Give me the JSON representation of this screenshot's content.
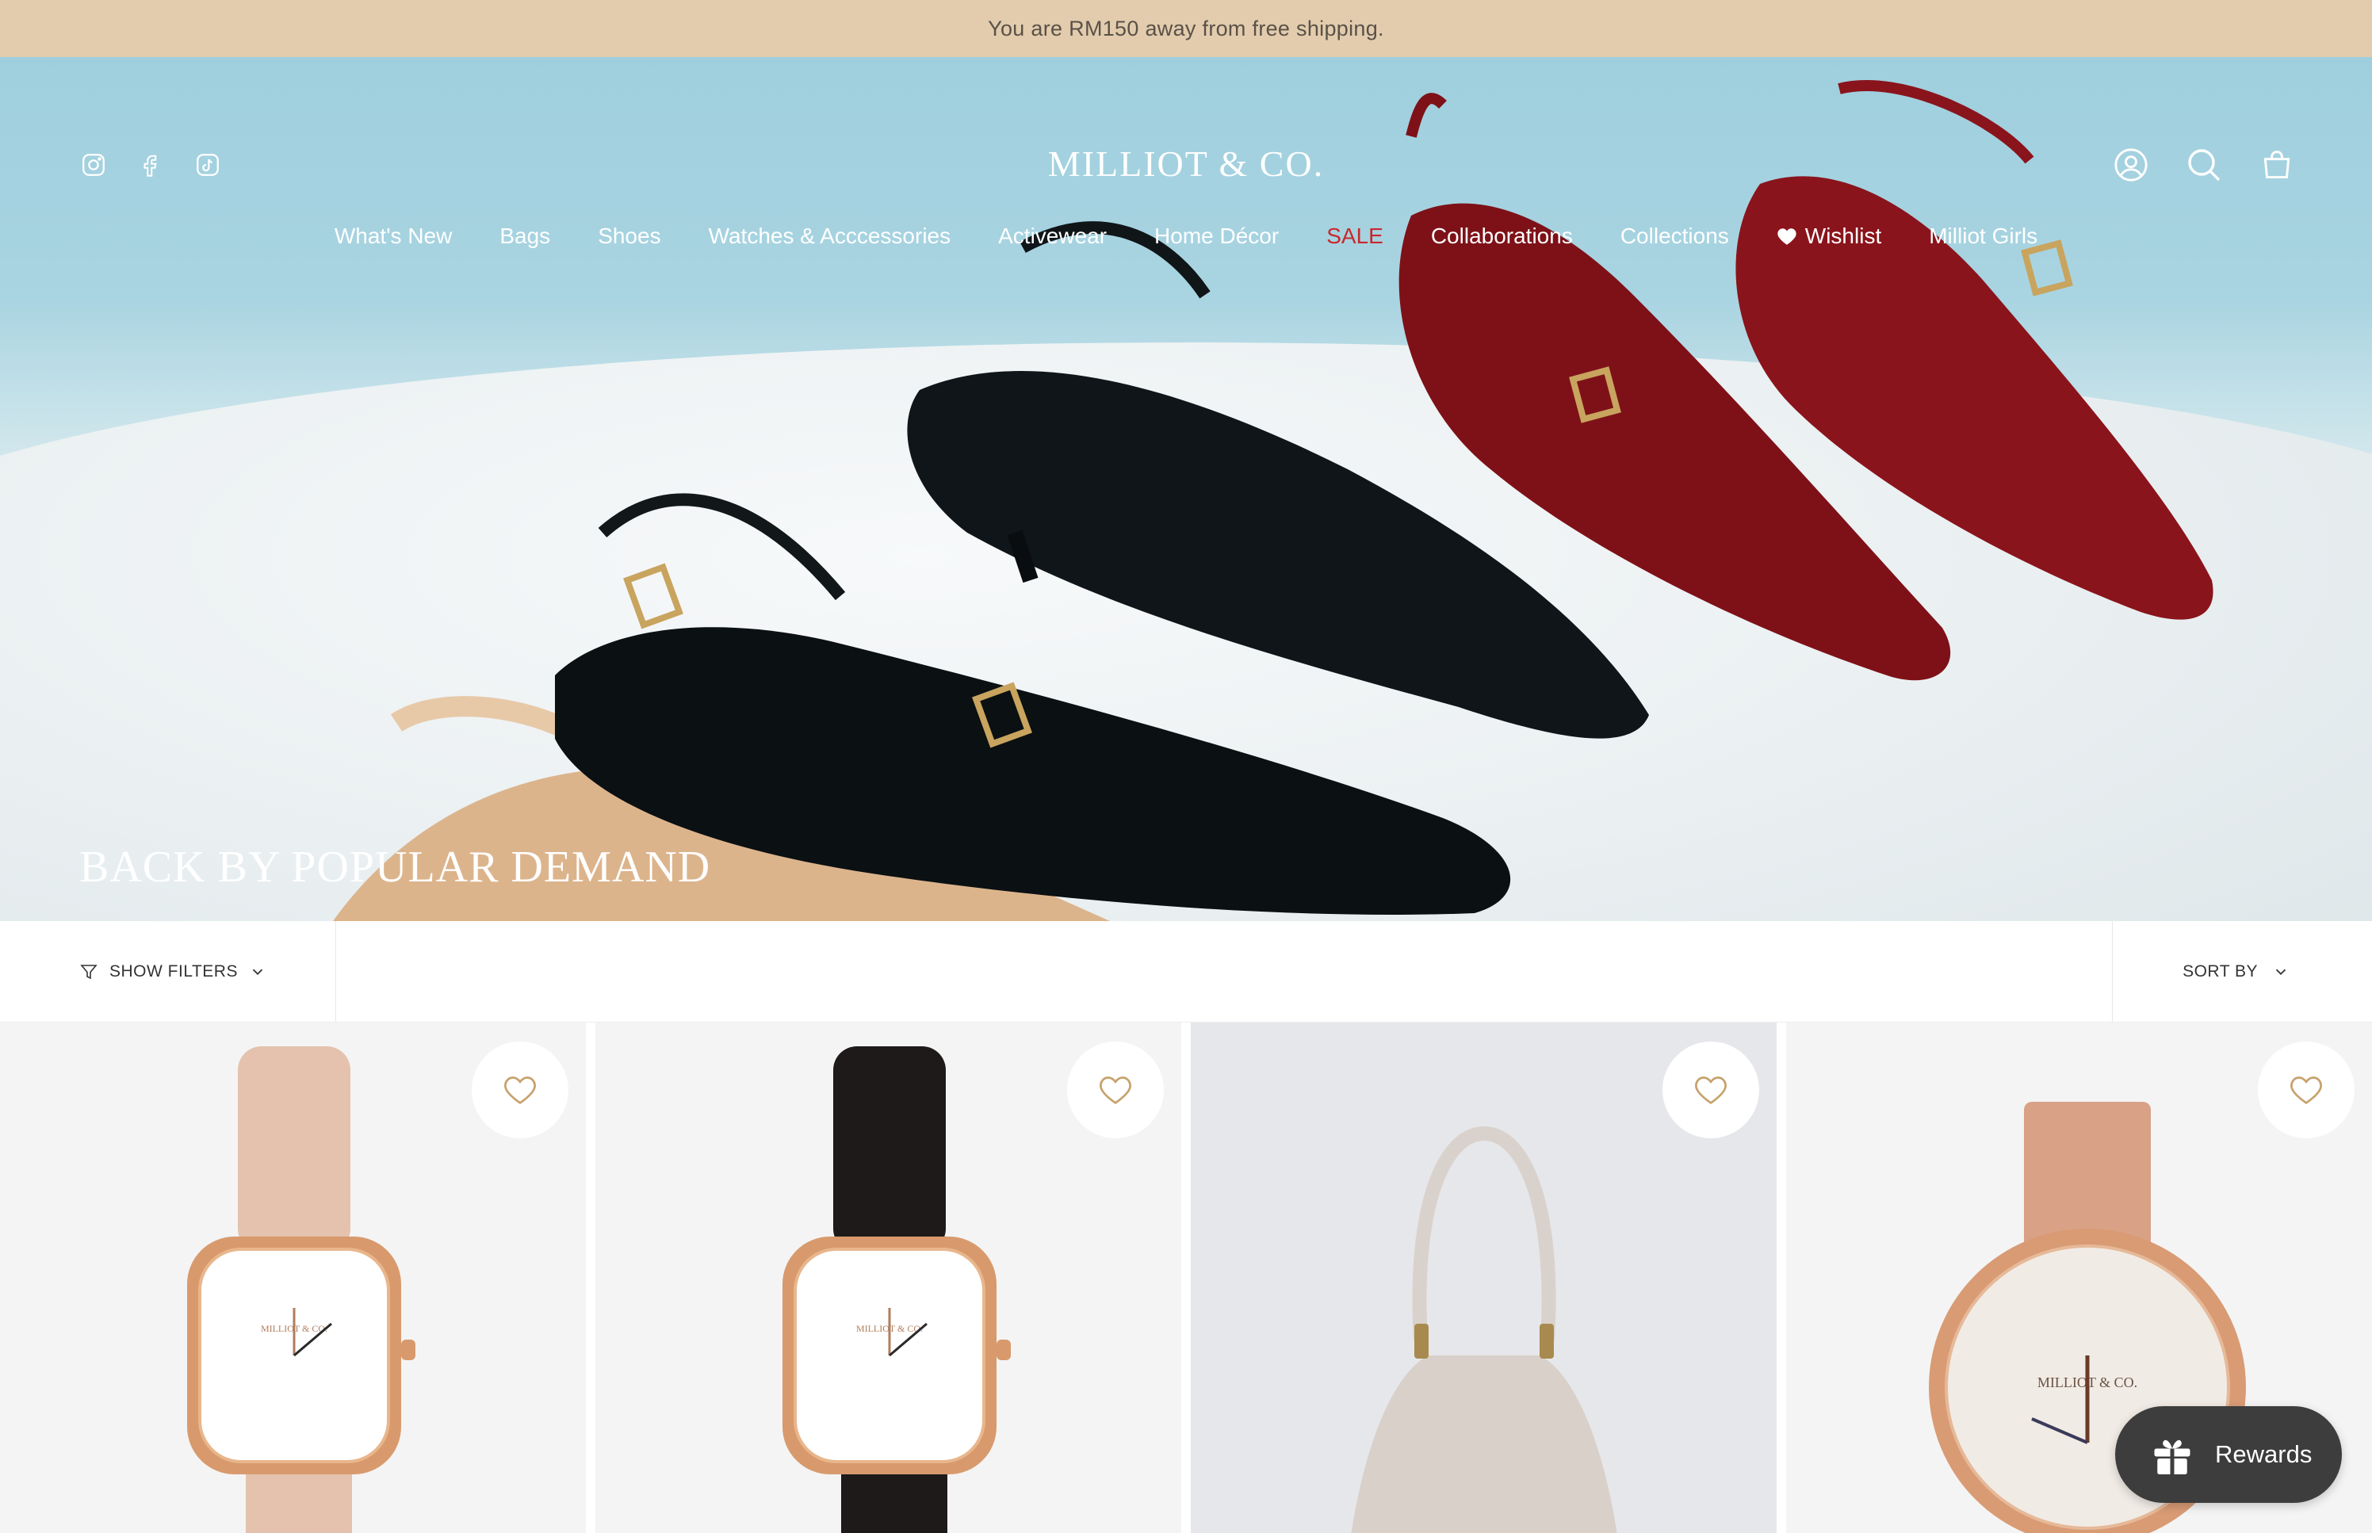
{
  "announcement": "You are RM150 away from free shipping.",
  "header": {
    "logo": "MILLIOT & CO.",
    "social_icons": [
      "instagram-icon",
      "facebook-icon",
      "tiktok-icon"
    ],
    "utility_icons": [
      "account-icon",
      "search-icon",
      "cart-icon"
    ]
  },
  "nav": {
    "items": [
      {
        "label": "What's New"
      },
      {
        "label": "Bags"
      },
      {
        "label": "Shoes"
      },
      {
        "label": "Watches & Acccessories"
      },
      {
        "label": "Activewear"
      },
      {
        "label": "Home Décor"
      },
      {
        "label": "SALE",
        "color": "#c9282d"
      },
      {
        "label": "Collaborations"
      },
      {
        "label": "Collections"
      },
      {
        "label": "Wishlist",
        "icon": "heart-icon"
      },
      {
        "label": "Milliot Girls"
      }
    ]
  },
  "hero": {
    "title": "BACK BY POPULAR DEMAND"
  },
  "filters": {
    "show_filters": "SHOW FILTERS",
    "sort_by": "SORT BY"
  },
  "watch_brand": "MILLIOT & CO.",
  "products": [
    {
      "type": "watch-square",
      "strap": "nude"
    },
    {
      "type": "watch-square",
      "strap": "black"
    },
    {
      "type": "shoulder-bag",
      "color": "cream"
    },
    {
      "type": "watch-round-mesh",
      "strap": "rose-gold"
    }
  ],
  "rewards": {
    "label": "Rewards"
  },
  "colors": {
    "announcement_bg": "#e2ccad",
    "sale": "#c9282d",
    "heart": "#c7a26c",
    "rewards_bg": "#3d3d3d"
  }
}
